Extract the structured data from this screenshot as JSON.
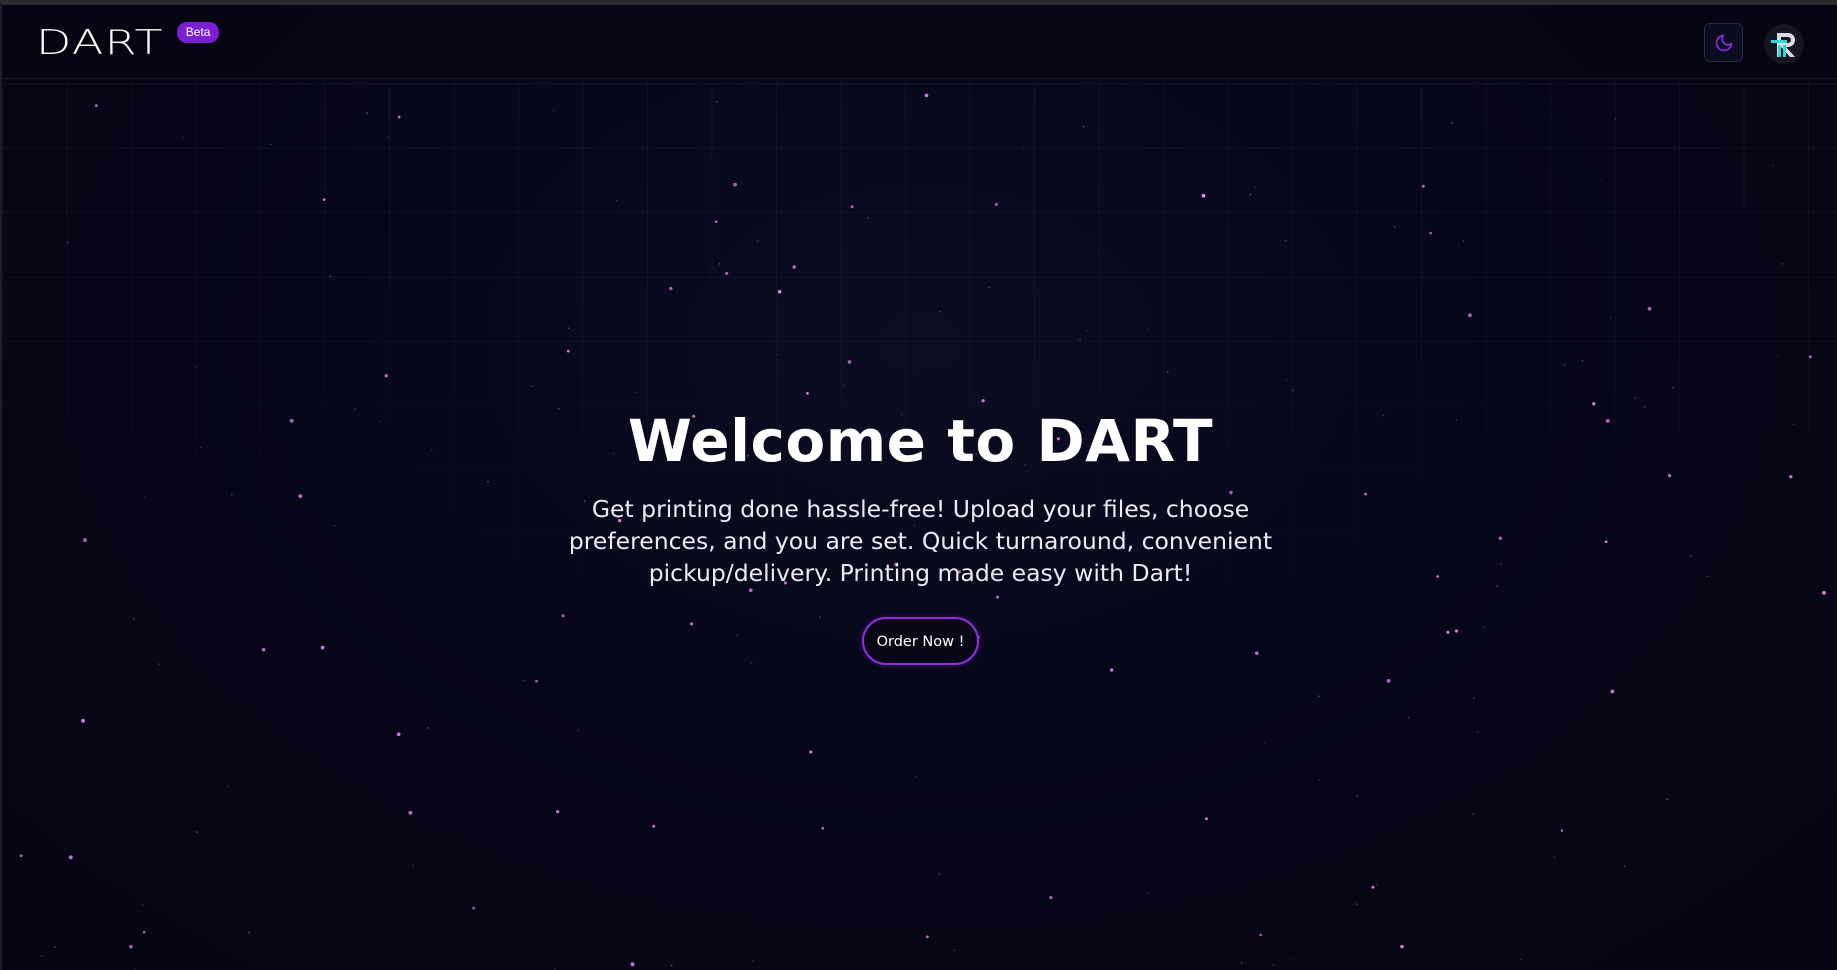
{
  "brand": {
    "logo_text": "DART",
    "badge": "Beta"
  },
  "header": {
    "theme_toggle_icon": "moon-icon",
    "avatar_icon": "user-logo-icon"
  },
  "hero": {
    "title": "Welcome to DART",
    "subtitle": "Get printing done hassle-free! Upload your files, choose preferences, and you are set. Quick turnaround, convenient pickup/delivery. Printing made easy with Dart!",
    "cta_label": "Order Now !"
  },
  "colors": {
    "background": "#060616",
    "accent": "#7a1fd4",
    "star": "#e08ae8",
    "avatar_accent": "#2fd6d6"
  }
}
